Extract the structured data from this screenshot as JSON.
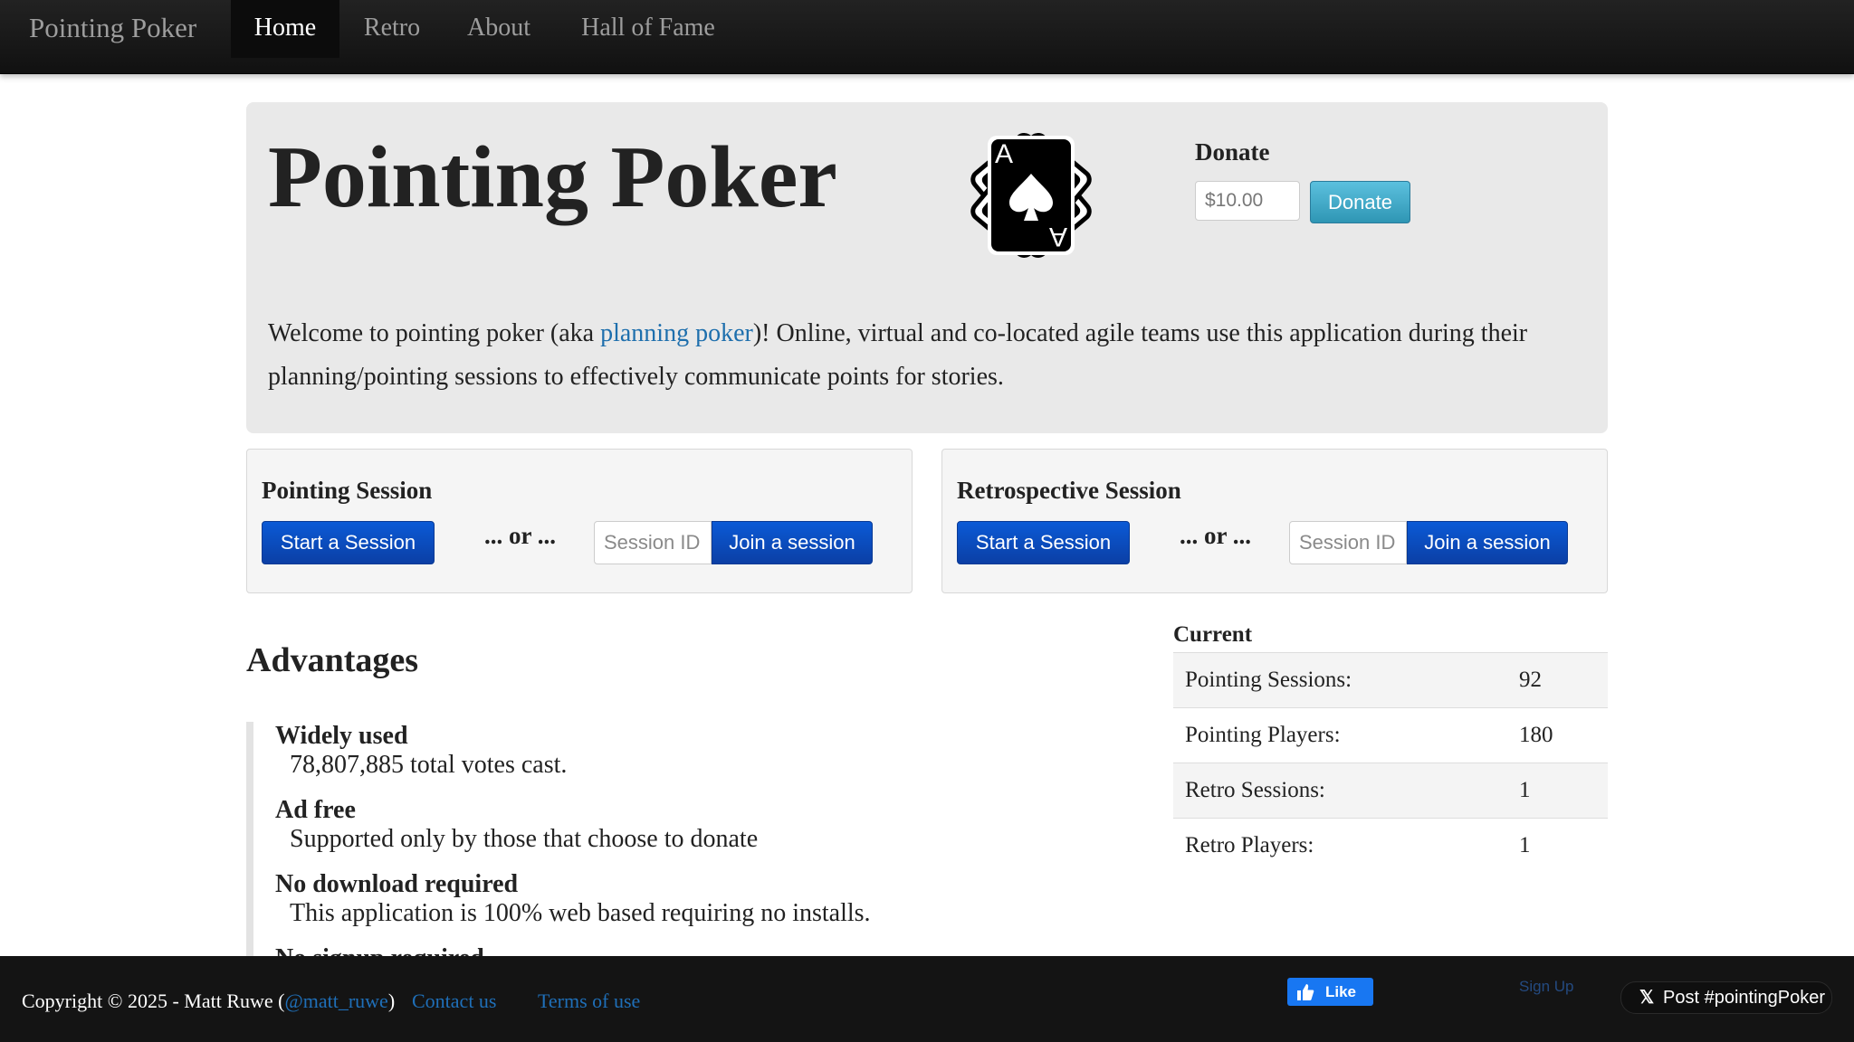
{
  "nav": {
    "brand": "Pointing Poker",
    "items": [
      {
        "label": "Home",
        "active": true
      },
      {
        "label": "Retro",
        "active": false
      },
      {
        "label": "About",
        "active": false
      },
      {
        "label": "Hall of Fame",
        "active": false
      }
    ]
  },
  "hero": {
    "title": "Pointing Poker",
    "icon": "playing-cards-icon",
    "card_letter": "A",
    "donate": {
      "label": "Donate",
      "amount_value": "$10.00",
      "button": "Donate"
    },
    "intro_before": "Welcome to pointing poker (aka ",
    "intro_link": "planning poker",
    "intro_after": ")! Online, virtual and co-located agile teams use this application during their planning/pointing sessions to effectively communicate points for stories."
  },
  "sessions": [
    {
      "title": "Pointing Session",
      "start_label": "Start a Session",
      "or_text": "... or ...",
      "id_placeholder": "Session ID",
      "join_label": "Join a session"
    },
    {
      "title": "Retrospective Session",
      "start_label": "Start a Session",
      "or_text": "... or ...",
      "id_placeholder": "Session ID",
      "join_label": "Join a session"
    }
  ],
  "advantages": {
    "heading": "Advantages",
    "items": [
      {
        "title": "Widely used",
        "desc": "78,807,885 total votes cast."
      },
      {
        "title": "Ad free",
        "desc": "Supported only by those that choose to donate"
      },
      {
        "title": "No download required",
        "desc": "This application is 100% web based requiring no installs."
      },
      {
        "title": "No signup required",
        "desc": ""
      }
    ]
  },
  "stats": {
    "caption": "Current",
    "rows": [
      {
        "label": "Pointing Sessions:",
        "value": "92"
      },
      {
        "label": "Pointing Players:",
        "value": "180"
      },
      {
        "label": "Retro Sessions:",
        "value": "1"
      },
      {
        "label": "Retro Players:",
        "value": "1"
      }
    ]
  },
  "footer": {
    "copyright_prefix": "Copyright © 2025 - Matt Ruwe (",
    "twitter_handle": "@matt_ruwe",
    "copyright_suffix": ")",
    "contact": "Contact us",
    "terms": "Terms of use",
    "fb_like": "Like",
    "signup": "Sign Up",
    "x_post": "Post #pointingPoker"
  },
  "colors": {
    "navbar": "#151515",
    "hero_bg": "#e9e9e9",
    "primary_button": "#0b4fc4",
    "info_button": "#49afcd",
    "link": "#1e6fad",
    "footer_bg": "#141414"
  }
}
